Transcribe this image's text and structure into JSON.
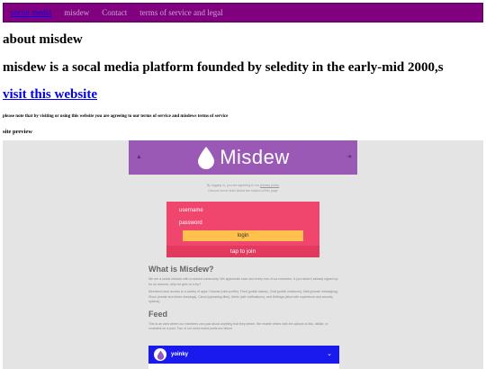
{
  "nav": {
    "items": [
      {
        "label": "social media"
      },
      {
        "label": "misdew"
      },
      {
        "label": "Contact"
      },
      {
        "label": "terms of service and legal"
      }
    ]
  },
  "main": {
    "heading": "about misdew",
    "description": "misdew is a socal media platform founded by seledity in the early-mid 2000,s",
    "visit_link": "visit this website",
    "note": "please note that by visiting or using this website you are agreeing to our terms of service and misdews terms of service",
    "preview_label": "site preview"
  },
  "preview": {
    "logo_text": "Misdew",
    "legal_line1": "By logging in, you are agreeing to our",
    "legal_link": "privacy policy",
    "legal_line2": "Discord server links linked the bottom of this page",
    "username_label": "username",
    "password_label": "password",
    "login_button": "login",
    "tap_to_join": "tap to join",
    "what_heading": "What is Misdew?",
    "what_p1": "We are a social network with a relaxed community. We appreciate each and every one of our members. If you haven't already signed up for an account, why not give us a try?",
    "what_p2": "Members have access to a variety of apps: Canvas (user profile), Feed (public status), Chat (public chatroom), Mail (private messaging), Show (create and share drawings), Cloud (uploading files), Alerts (site notifications), and Settings (allow site experience and security options).",
    "feed_heading": "Feed",
    "feed_p": "This is an area where our members can post about anything that they desire. We enable others with the options to like, dislike, or comment on a post. Two of our most recent posts are below.",
    "post_user": "yoinky"
  },
  "colors": {
    "nav_bg": "#800080",
    "preview_header": "#9b59b6",
    "login_box": "#f0466e",
    "login_button": "#ffc04d",
    "post_bar": "#1a1aee"
  }
}
